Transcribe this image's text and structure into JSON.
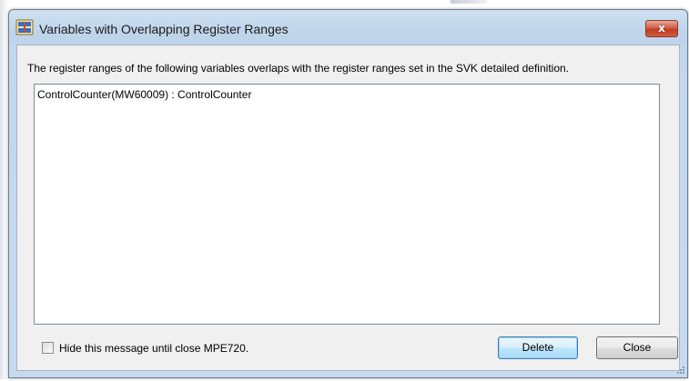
{
  "window": {
    "title": "Variables with Overlapping Register Ranges",
    "close_label": "x"
  },
  "message": "The register ranges of the following variables overlaps with the register ranges set in the SVK detailed definition.",
  "list": {
    "items": [
      "ControlCounter(MW60009) : ControlCounter"
    ]
  },
  "checkbox": {
    "label": "Hide this message until close MPE720.",
    "checked": false
  },
  "buttons": {
    "delete_label": "Delete",
    "close_label": "Close"
  },
  "colors": {
    "title_bar": "#bdd3ea",
    "close_button": "#c13c24",
    "client_bg": "#f0f0f0",
    "default_button": "#bee6fd"
  }
}
